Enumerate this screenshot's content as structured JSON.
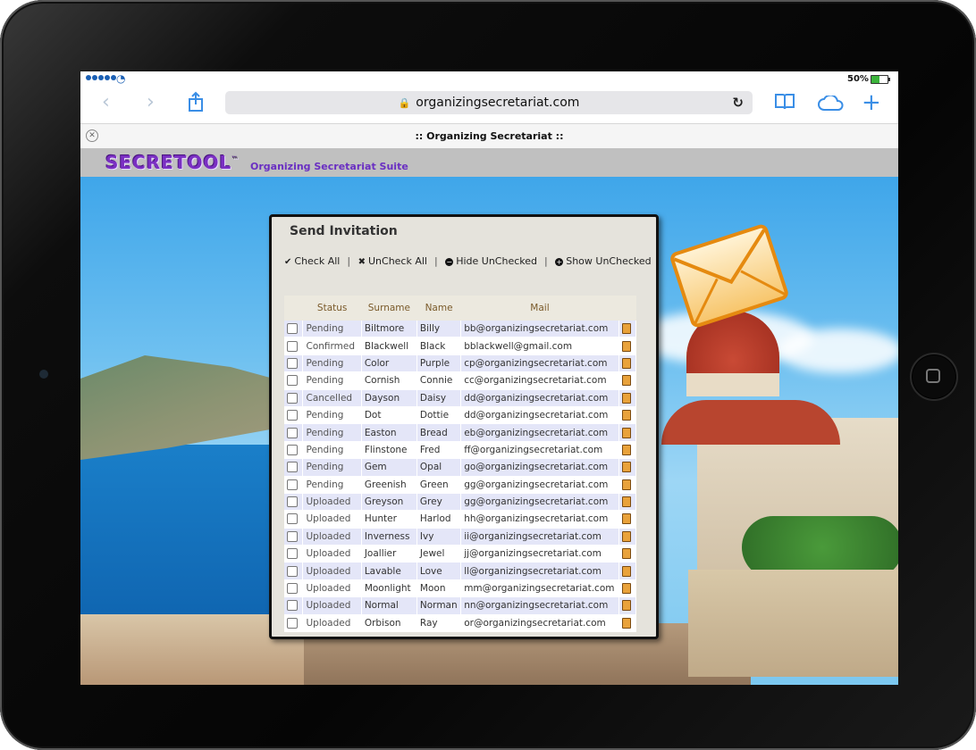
{
  "browser": {
    "battery_text": "50%",
    "url": "organizingsecretariat.com",
    "tab_title": ":: Organizing Secretariat ::"
  },
  "site": {
    "logo_text": "SECRETOOL",
    "logo_tm": "™",
    "tagline": "Organizing Secretariat Suite"
  },
  "dialog": {
    "title": "Send Invitation",
    "toolbar": {
      "check_all": "Check All",
      "uncheck_all": "UnCheck All",
      "hide_unchecked": "Hide UnChecked",
      "show_unchecked": "Show UnChecked",
      "separator": "|"
    },
    "columns": [
      "Status",
      "Surname",
      "Name",
      "Mail"
    ],
    "rows": [
      {
        "status": "Pending",
        "surname": "Biltmore",
        "name": "Billy",
        "mail": "bb@organizingsecretariat.com"
      },
      {
        "status": "Confirmed",
        "surname": "Blackwell",
        "name": "Black",
        "mail": "bblackwell@gmail.com"
      },
      {
        "status": "Pending",
        "surname": "Color",
        "name": "Purple",
        "mail": "cp@organizingsecretariat.com"
      },
      {
        "status": "Pending",
        "surname": "Cornish",
        "name": "Connie",
        "mail": "cc@organizingsecretariat.com"
      },
      {
        "status": "Cancelled",
        "surname": "Dayson",
        "name": "Daisy",
        "mail": "dd@organizingsecretariat.com"
      },
      {
        "status": "Pending",
        "surname": "Dot",
        "name": "Dottie",
        "mail": "dd@organizingsecretariat.com"
      },
      {
        "status": "Pending",
        "surname": "Easton",
        "name": "Bread",
        "mail": "eb@organizingsecretariat.com"
      },
      {
        "status": "Pending",
        "surname": "Flinstone",
        "name": "Fred",
        "mail": "ff@organizingsecretariat.com"
      },
      {
        "status": "Pending",
        "surname": "Gem",
        "name": "Opal",
        "mail": "go@organizingsecretariat.com"
      },
      {
        "status": "Pending",
        "surname": "Greenish",
        "name": "Green",
        "mail": "gg@organizingsecretariat.com"
      },
      {
        "status": "Uploaded",
        "surname": "Greyson",
        "name": "Grey",
        "mail": "gg@organizingsecretariat.com"
      },
      {
        "status": "Uploaded",
        "surname": "Hunter",
        "name": "Harlod",
        "mail": "hh@organizingsecretariat.com"
      },
      {
        "status": "Uploaded",
        "surname": "Inverness",
        "name": "Ivy",
        "mail": "ii@organizingsecretariat.com"
      },
      {
        "status": "Uploaded",
        "surname": "Joallier",
        "name": "Jewel",
        "mail": "jj@organizingsecretariat.com"
      },
      {
        "status": "Uploaded",
        "surname": "Lavable",
        "name": "Love",
        "mail": "ll@organizingsecretariat.com"
      },
      {
        "status": "Uploaded",
        "surname": "Moonlight",
        "name": "Moon",
        "mail": "mm@organizingsecretariat.com"
      },
      {
        "status": "Uploaded",
        "surname": "Normal",
        "name": "Norman",
        "mail": "nn@organizingsecretariat.com"
      },
      {
        "status": "Uploaded",
        "surname": "Orbison",
        "name": "Ray",
        "mail": "or@organizingsecretariat.com"
      }
    ]
  },
  "icons": {
    "back": "chevron-left-icon",
    "forward": "chevron-right-icon",
    "share": "share-icon",
    "reload": "reload-icon",
    "bookmarks": "book-icon",
    "cloud": "cloud-icon",
    "new_tab": "plus-icon",
    "mail": "envelope-icon"
  },
  "colors": {
    "accent": "#3a8ee6",
    "logo": "#7a2fc2",
    "row_alt": "#e4e6f8",
    "envelope": "#f5a623"
  }
}
